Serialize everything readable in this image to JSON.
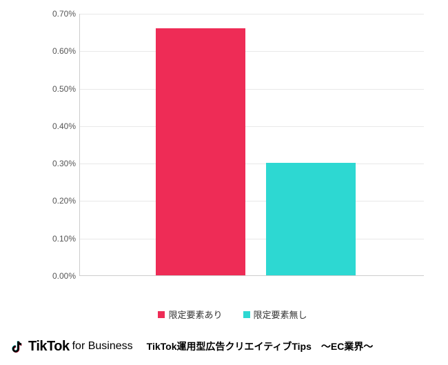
{
  "chart_data": {
    "type": "bar",
    "categories": [
      "限定要素あり",
      "限定要素無し"
    ],
    "values": [
      0.66,
      0.3
    ],
    "title": "",
    "xlabel": "",
    "ylabel": "",
    "ylim": [
      0,
      0.7
    ],
    "y_ticks": [
      "0.00%",
      "0.10%",
      "0.20%",
      "0.30%",
      "0.40%",
      "0.50%",
      "0.60%",
      "0.70%"
    ],
    "colors": [
      "#ee2c56",
      "#2dd8d2"
    ]
  },
  "legend": {
    "items": [
      {
        "label": "限定要素あり"
      },
      {
        "label": "限定要素無し"
      }
    ]
  },
  "footer": {
    "brand_main": "TikTok",
    "brand_sub": "for Business",
    "caption": "TikTok運用型広告クリエイティブTips　〜EC業界〜"
  }
}
